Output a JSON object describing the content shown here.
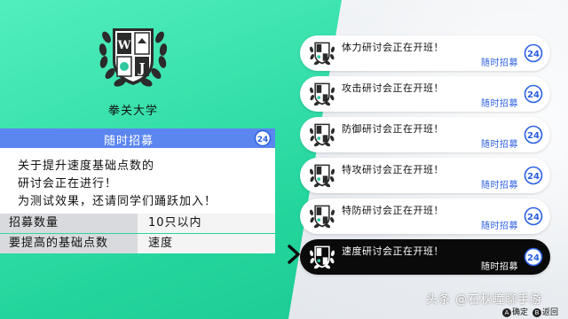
{
  "school": {
    "name": "拳关大学",
    "emblem_letters": [
      "W",
      "J"
    ]
  },
  "recruit": {
    "header": "随时招募",
    "badge": "24",
    "description": [
      "关于提升速度基础点数的",
      "研讨会正在进行！",
      "为测试效果，还请同学们踊跃加入！"
    ],
    "stats": [
      {
        "label": "招募数量",
        "value": "10只以内"
      },
      {
        "label": "要提高的基础点数",
        "value": "速度"
      }
    ]
  },
  "seminars": [
    {
      "title": "体力研讨会正在开班！",
      "tag": "随时招募",
      "badge": "24",
      "selected": false
    },
    {
      "title": "攻击研讨会正在开班！",
      "tag": "随时招募",
      "badge": "24",
      "selected": false
    },
    {
      "title": "防御研讨会正在开班！",
      "tag": "随时招募",
      "badge": "24",
      "selected": false
    },
    {
      "title": "特攻研讨会正在开班！",
      "tag": "随时招募",
      "badge": "24",
      "selected": false
    },
    {
      "title": "特防研讨会正在开班！",
      "tag": "随时招募",
      "badge": "24",
      "selected": false
    },
    {
      "title": "速度研讨会正在开班！",
      "tag": "随时招募",
      "badge": "24",
      "selected": true
    }
  ],
  "footer": {
    "watermark": "头条 @石秋瞳聊手游",
    "confirm_button": "A",
    "confirm_label": "确定",
    "back_button": "B",
    "back_label": "返回"
  },
  "colors": {
    "green": "#2fe0a8",
    "header_blue": "#5b86f0",
    "tag_blue": "#2a5fe0",
    "selected_card": "#0a0a0a"
  }
}
